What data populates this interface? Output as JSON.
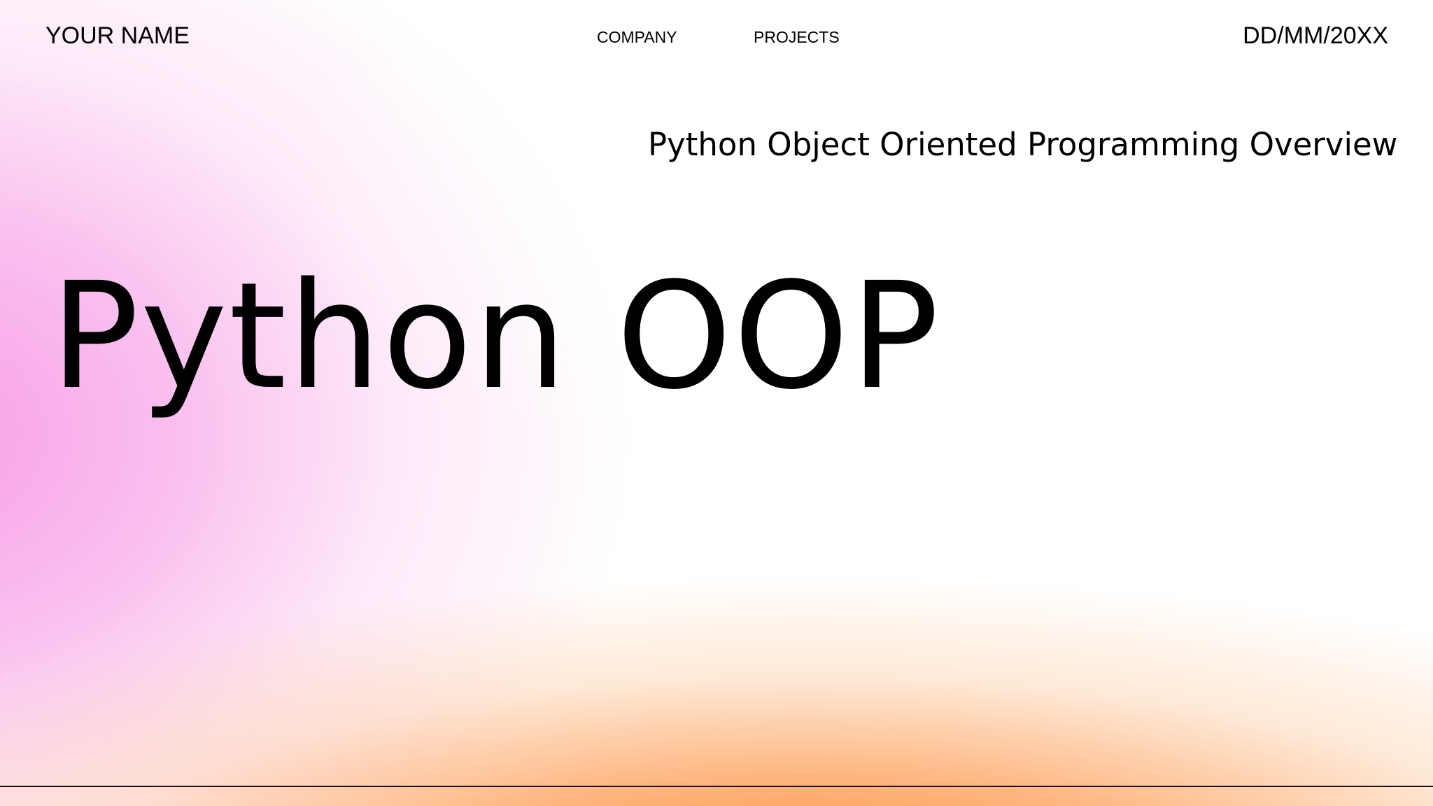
{
  "header": {
    "author": "YOUR NAME",
    "nav": [
      "COMPANY",
      "PROJECTS"
    ],
    "date": "DD/MM/20XX"
  },
  "slide": {
    "subtitle": "Python Object Oriented Programming Overview",
    "title": "Python OOP"
  },
  "colors": {
    "text": "#000000",
    "gradient_pink": "#F79EE5",
    "gradient_orange": "#FC8428",
    "background": "#FFFFFF"
  }
}
